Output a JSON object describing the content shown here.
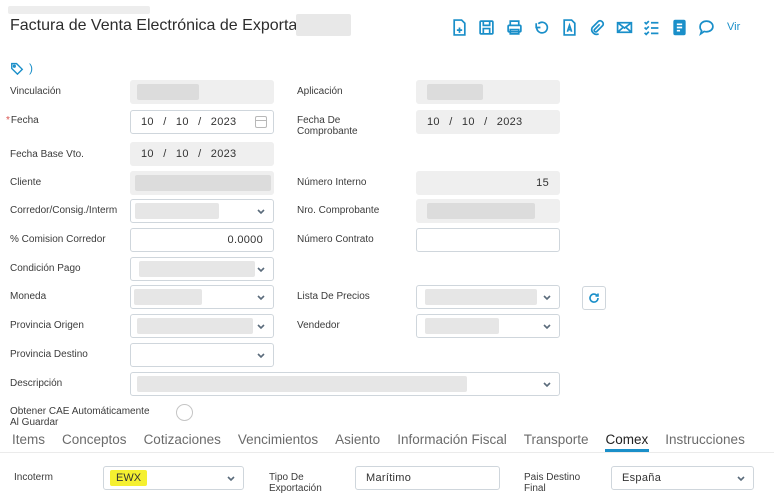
{
  "header": {
    "title": "Factura de Venta Electrónica de Exportación",
    "more_label": "Vir"
  },
  "toolbar": [
    "new-doc-icon",
    "save-icon",
    "print-icon",
    "revert-icon",
    "pdf-icon",
    "attach-icon",
    "mail-icon",
    "checklist-icon",
    "notes-icon",
    "comment-icon"
  ],
  "form": {
    "vinculacion_label": "Vinculación",
    "aplicacion_label": "Aplicación",
    "fecha_label": "Fecha",
    "fecha_value": "10 / 10 / 2023",
    "fecha_comprobante_label1": "Fecha De",
    "fecha_comprobante_label2": "Comprobante",
    "fecha_comprobante_value": "10 / 10 / 2023",
    "fecha_base_label": "Fecha Base Vto.",
    "fecha_base_value": "10 / 10 / 2023",
    "cliente_label": "Cliente",
    "numero_interno_label": "Número Interno",
    "numero_interno_value": "15",
    "corredor_label": "Corredor/Consig./Interm",
    "nro_comprobante_label": "Nro. Comprobante",
    "comision_label": "% Comision Corredor",
    "comision_value": "0.0000",
    "numero_contrato_label": "Número Contrato",
    "condicion_pago_label": "Condición Pago",
    "moneda_label": "Moneda",
    "lista_precios_label": "Lista De Precios",
    "provincia_origen_label": "Provincia Origen",
    "vendedor_label": "Vendedor",
    "provincia_destino_label": "Provincia Destino",
    "descripcion_label": "Descripción",
    "cae_label1": "Obtener CAE Automáticamente",
    "cae_label2": "Al Guardar"
  },
  "tabs": [
    "Items",
    "Conceptos",
    "Cotizaciones",
    "Vencimientos",
    "Asiento",
    "Información Fiscal",
    "Transporte",
    "Comex",
    "Instrucciones"
  ],
  "active_tab": "Comex",
  "comex": {
    "incoterm_label": "Incoterm",
    "incoterm_value": "EWX",
    "tipo_exportacion_label1": "Tipo De",
    "tipo_exportacion_label2": "Exportación",
    "tipo_exportacion_value": "Marítimo",
    "pais_destino_label1": "Pais Destino",
    "pais_destino_label2": "Final",
    "pais_destino_value": "España"
  },
  "colors": {
    "accent": "#1a8fc9",
    "highlight": "#f5f030",
    "required": "#d9534f"
  }
}
